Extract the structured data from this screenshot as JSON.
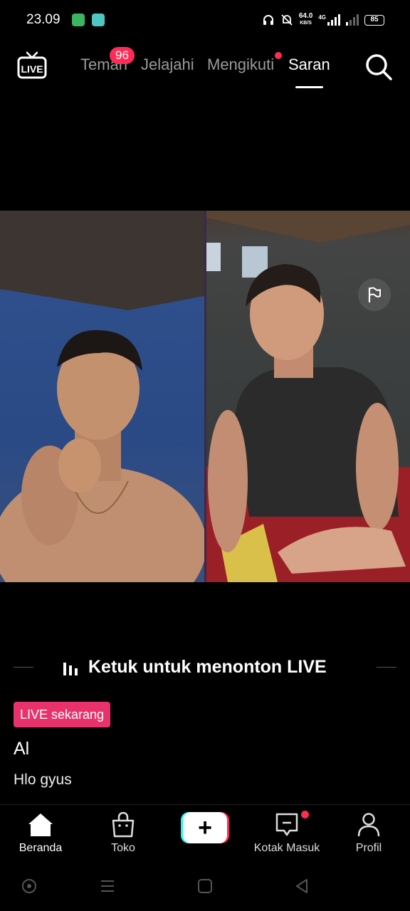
{
  "status_bar": {
    "time": "23.09",
    "net_speed_value": "64.0",
    "net_speed_unit": "KB/S",
    "network_type": "4G",
    "battery": "85"
  },
  "top_nav": {
    "tabs": [
      {
        "label": "Teman",
        "active": false
      },
      {
        "label": "Jelajahi",
        "active": false
      },
      {
        "label": "Mengikuti",
        "active": false
      },
      {
        "label": "Saran",
        "active": true
      }
    ],
    "friends_badge": "96",
    "live_icon_text": "LIVE"
  },
  "live": {
    "watch_prompt": "Ketuk untuk menonton LIVE",
    "live_badge": "LIVE sekarang",
    "user_name": "Al",
    "caption": "Hlo gyus"
  },
  "bottom_nav": {
    "items": [
      {
        "label": "Beranda",
        "icon": "home-icon",
        "active": true
      },
      {
        "label": "Toko",
        "icon": "shopping-bag-icon",
        "active": false
      },
      {
        "label": "+",
        "icon": "create-icon",
        "active": false
      },
      {
        "label": "Kotak Masuk",
        "icon": "inbox-icon",
        "active": false
      },
      {
        "label": "Profil",
        "icon": "profile-icon",
        "active": false
      }
    ]
  },
  "colors": {
    "accent": "#fe2c55",
    "live_badge_bg": "#e8326c",
    "create_cyan": "#25f4ee",
    "background": "#000000"
  }
}
